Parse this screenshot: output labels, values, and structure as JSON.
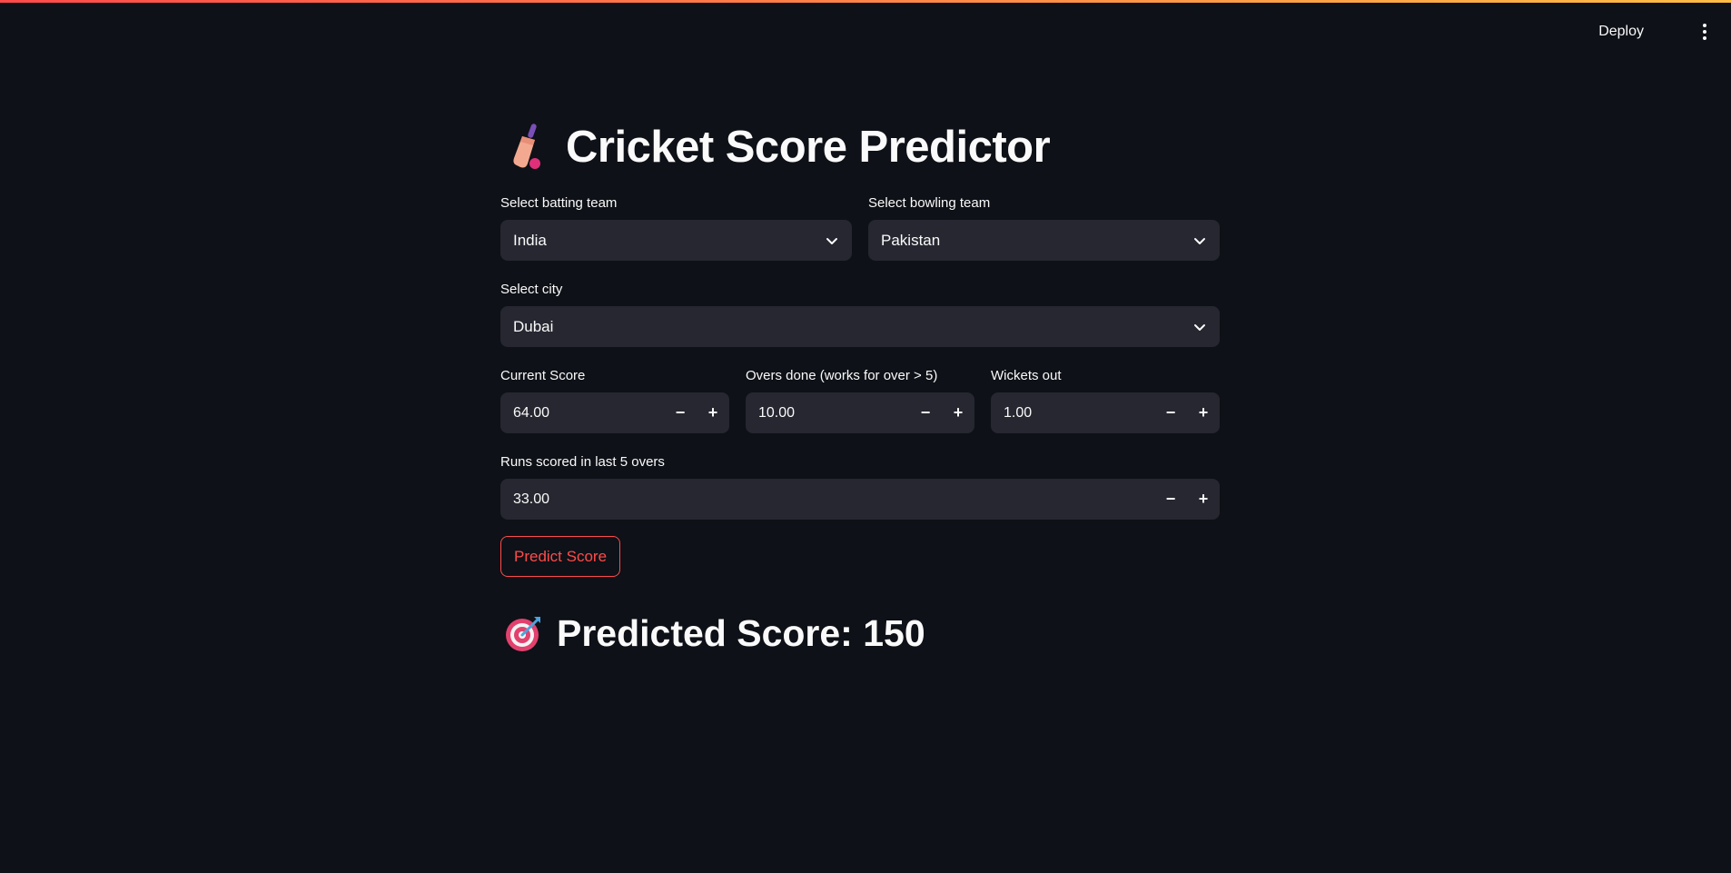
{
  "header": {
    "deploy_label": "Deploy",
    "menu_icon": "kebab-menu-icon"
  },
  "title": {
    "icon": "cricket-bat-icon",
    "text": "Cricket Score Predictor"
  },
  "fields": {
    "batting_team": {
      "label": "Select batting team",
      "value": "India"
    },
    "bowling_team": {
      "label": "Select bowling team",
      "value": "Pakistan"
    },
    "city": {
      "label": "Select city",
      "value": "Dubai"
    },
    "current_score": {
      "label": "Current Score",
      "value": "64.00"
    },
    "overs_done": {
      "label": "Overs done (works for over > 5)",
      "value": "10.00"
    },
    "wickets_out": {
      "label": "Wickets out",
      "value": "1.00"
    },
    "last_five": {
      "label": "Runs scored in last 5 overs",
      "value": "33.00"
    }
  },
  "stepper": {
    "minus": "−",
    "plus": "+"
  },
  "predict_button": "Predict Score",
  "result": {
    "icon": "target-icon",
    "text": "Predicted Score: 150"
  },
  "colors": {
    "background": "#0e1117",
    "input_bg": "#262730",
    "accent": "#ff4b4b"
  }
}
